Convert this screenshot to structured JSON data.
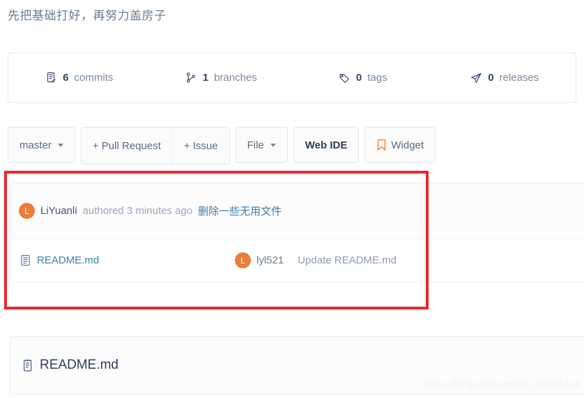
{
  "repo": {
    "description": "先把基础打好，再努力盖房子"
  },
  "stats": [
    {
      "icon": "commits-icon",
      "count": "6",
      "label": "commits"
    },
    {
      "icon": "branch-icon",
      "count": "1",
      "label": "branches"
    },
    {
      "icon": "tag-icon",
      "count": "0",
      "label": "tags"
    },
    {
      "icon": "release-icon",
      "count": "0",
      "label": "releases"
    }
  ],
  "toolbar": {
    "branch_button": "master",
    "pull_request_button": "+ Pull Request",
    "issue_button": "+ Issue",
    "file_button": "File",
    "web_ide_button": "Web IDE",
    "widget_button": "Widget",
    "widget_icon": "bookmark-icon"
  },
  "latest_commit": {
    "avatar_initial": "L",
    "author": "LiYuanli",
    "meta": "authored 3 minutes ago",
    "message": "删除一些无用文件"
  },
  "files": [
    {
      "icon": "file-icon",
      "name": "README.md",
      "avatar_initial": "L",
      "author": "lyl521",
      "commit_message": "Update README.md"
    }
  ],
  "readme_panel": {
    "icon": "readme-icon",
    "title": "README.md"
  },
  "annotation": {
    "highlight_color": "#e8292c"
  },
  "watermark": {
    "text": "https://blog.csdn.net/qq_40224714"
  }
}
